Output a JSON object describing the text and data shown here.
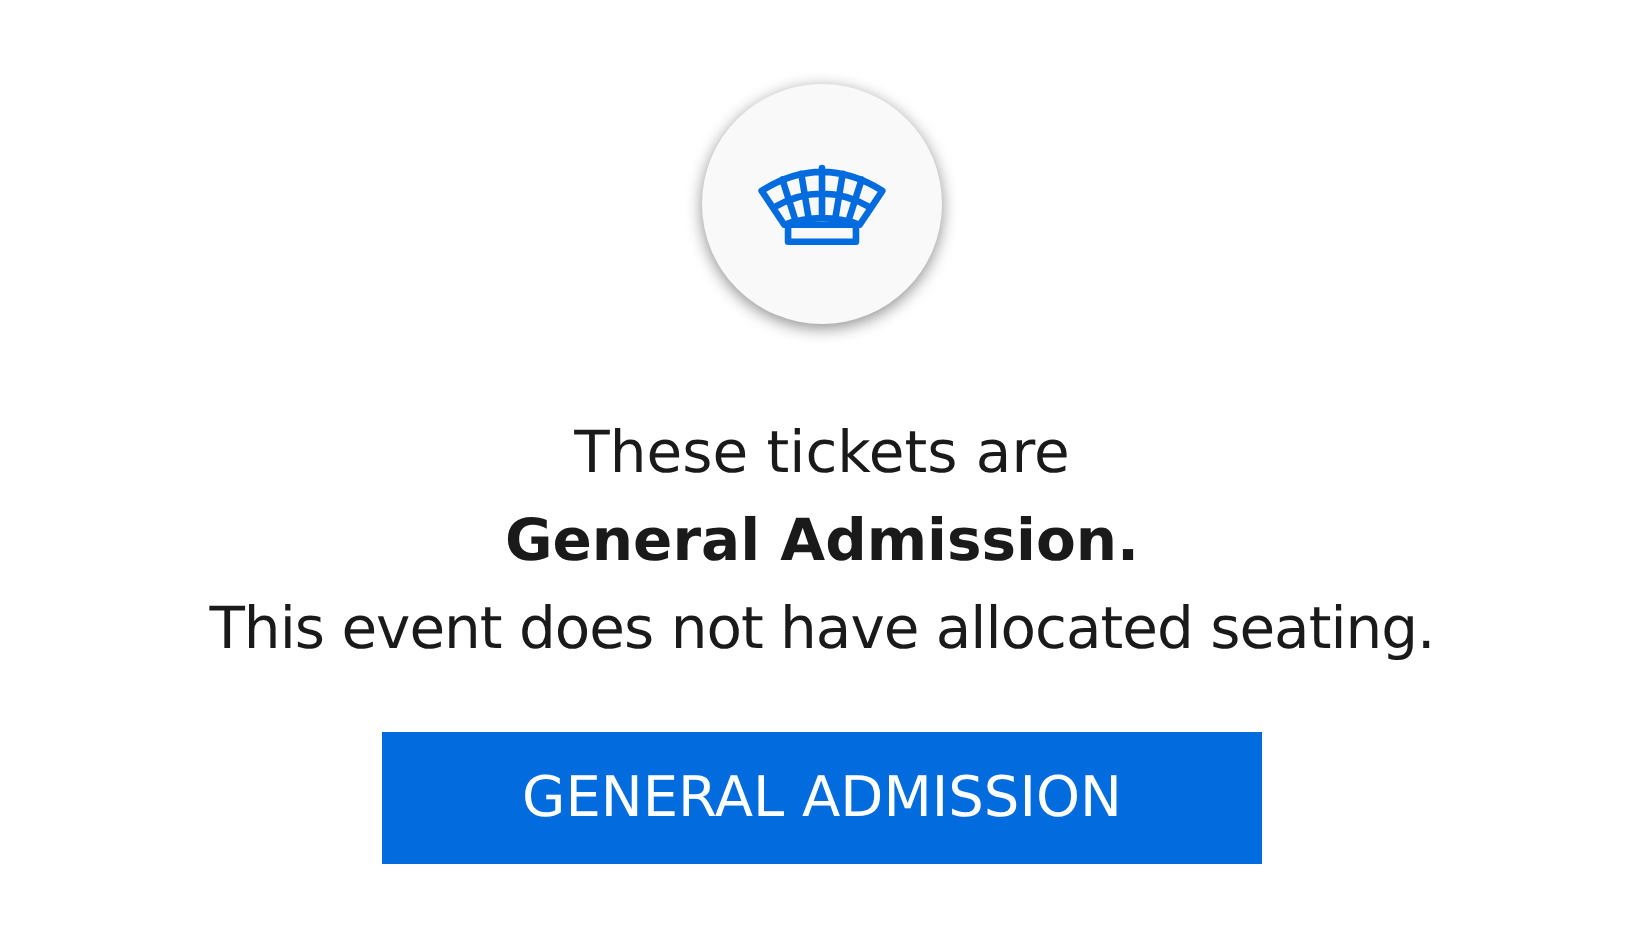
{
  "message": {
    "line_1": "These tickets are",
    "line_2": "General Admission.",
    "line_3": "This event does not have allocated seating."
  },
  "button": {
    "label": "GENERAL ADMISSION"
  }
}
